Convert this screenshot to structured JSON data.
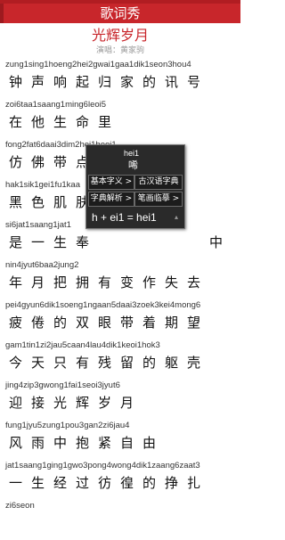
{
  "app_title": "歌词秀",
  "song_title": "光辉岁月",
  "singer_line": "演唱：黄家驹",
  "lyrics": [
    {
      "py": "zung1sing1hoeng2hei2gwai1gaa1dik1seon3hou4",
      "zh": "钟声响起归家的讯号"
    },
    {
      "py": "zoi6taa1saang1ming6leoi5",
      "zh": "在他生命里"
    },
    {
      "py": "fong2fat6daai3dim2hei1heoi1",
      "zh": "仿佛带点唏嘘"
    },
    {
      "py": "hak1sik1gei1fu1kaa",
      "zh": "黑色肌肤给"
    },
    {
      "py": "si6jat1saang1jat1",
      "zh": "是一生奉　　　　　中"
    },
    {
      "py": "nin4jyut6baa2jung2",
      "zh": "年月把拥有变作失去"
    },
    {
      "py": "pei4gyun6dik1soeng1ngaan5daai3zoek3kei4mong6",
      "zh": "疲倦的双眼带着期望"
    },
    {
      "py": "gam1tin1zi2jau5caan4lau4dik1keoi1hok3",
      "zh": "今天只有残留的躯壳"
    },
    {
      "py": "jing4zip3gwong1fai1seoi3jyut6",
      "zh": "迎接光辉岁月"
    },
    {
      "py": "fung1jyu5zung1pou3gan2zi6jau4",
      "zh": "风雨中抱紧自由"
    },
    {
      "py": "jat1saang1ging1gwo3pong4wong4dik1zaang6zaat3",
      "zh": "一生经过彷徨的挣扎"
    },
    {
      "py": "zi6seon",
      "zh": ""
    }
  ],
  "popup": {
    "pinyin": "hei1",
    "char": "唏",
    "btn_basic": "基本字义 >",
    "btn_classic": "古汉语字典",
    "btn_explain": "字典解析 >",
    "btn_stroke": "笔画临摹 >",
    "formula": "h + ei1 = hei1"
  },
  "colors": {
    "accent": "#c8262b",
    "popup_bg": "#2a2a2a"
  },
  "icons": {
    "speaker": "speaker-icon"
  }
}
